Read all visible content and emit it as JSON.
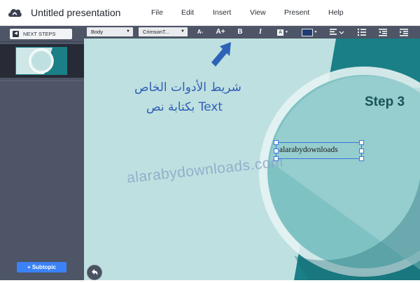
{
  "app": {
    "title": "Untitled presentation"
  },
  "menu": [
    "File",
    "Edit",
    "Insert",
    "View",
    "Present",
    "Help"
  ],
  "sidebar": {
    "next_steps_label": "NEXT STEPS",
    "subtopic_label": "+ Subtopic"
  },
  "toolbar": {
    "style_select": "Body",
    "font_select": "CrimsonT...",
    "decrease_font": "A-",
    "increase_font": "A+",
    "bold": "B",
    "italic": "I",
    "text_color": "A",
    "fill_color": "#1f3b73"
  },
  "slide": {
    "annotation_line1": "شريط الأدوات الخاص",
    "annotation_line2": "بكتابة نص Text",
    "watermark": "alarabydownloads.com",
    "step_label": "Step 3",
    "textbox_text": "alarabydownloads"
  },
  "colors": {
    "accent": "#3b82f6",
    "panel": "#4d5566",
    "canvas": "#bfe0e0",
    "teal": "#1a7f86"
  },
  "icons": [
    "cloud-logo-icon",
    "arrow-left-icon",
    "bold-icon",
    "italic-icon",
    "align-left-icon",
    "bullet-list-icon",
    "indent-decrease-icon",
    "indent-increase-icon",
    "undo-icon"
  ]
}
